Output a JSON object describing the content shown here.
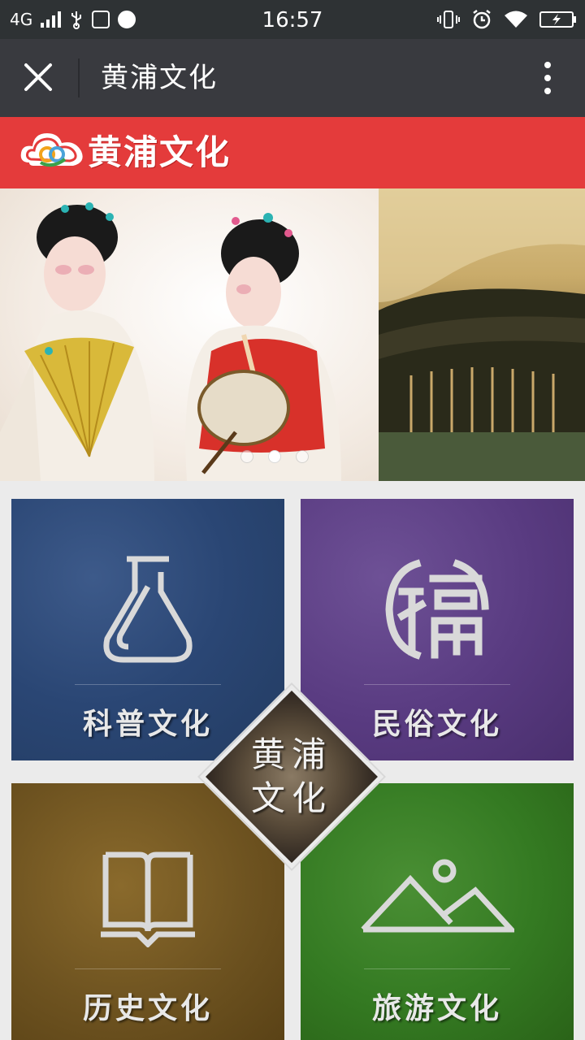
{
  "status_bar": {
    "network": "4G",
    "time": "16:57"
  },
  "nav": {
    "title": "黄浦文化",
    "close_icon": "close-icon",
    "more_icon": "more-vertical-icon"
  },
  "brand": {
    "name": "黄浦文化",
    "color": "#e43b3b"
  },
  "banner": {
    "slide_count": 3,
    "active_slide": 2
  },
  "tiles": [
    {
      "label": "科普文化",
      "icon": "flask-icon",
      "color": "#2a4674"
    },
    {
      "label": "民俗文化",
      "icon": "fu-character-icon",
      "color": "#593b81"
    },
    {
      "label": "历史文化",
      "icon": "book-icon",
      "color": "#6e5320"
    },
    {
      "label": "旅游文化",
      "icon": "mountain-icon",
      "color": "#347a22"
    }
  ],
  "center": {
    "line1": "黄浦",
    "line2": "文化"
  }
}
